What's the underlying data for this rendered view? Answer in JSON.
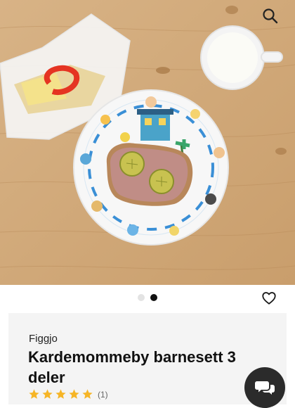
{
  "product": {
    "brand": "Figgjo",
    "title": "Kardemommeby barnesett 3 deler",
    "rating": 5,
    "review_count": "(1)",
    "image_alt": "Plate with liver pate sandwich, wrapped sandwich and cup of milk"
  },
  "gallery": {
    "slides": 2,
    "active_index": 1
  },
  "icons": {
    "search": "search-icon",
    "favorite": "heart-icon",
    "chat": "chat-bubbles-icon",
    "star": "star-icon"
  },
  "colors": {
    "star": "#f6b526",
    "chat_bg": "#2b2b2b",
    "dot_active": "#111111",
    "dot_inactive": "#e3e3e3",
    "card_bg": "#f4f4f4"
  }
}
